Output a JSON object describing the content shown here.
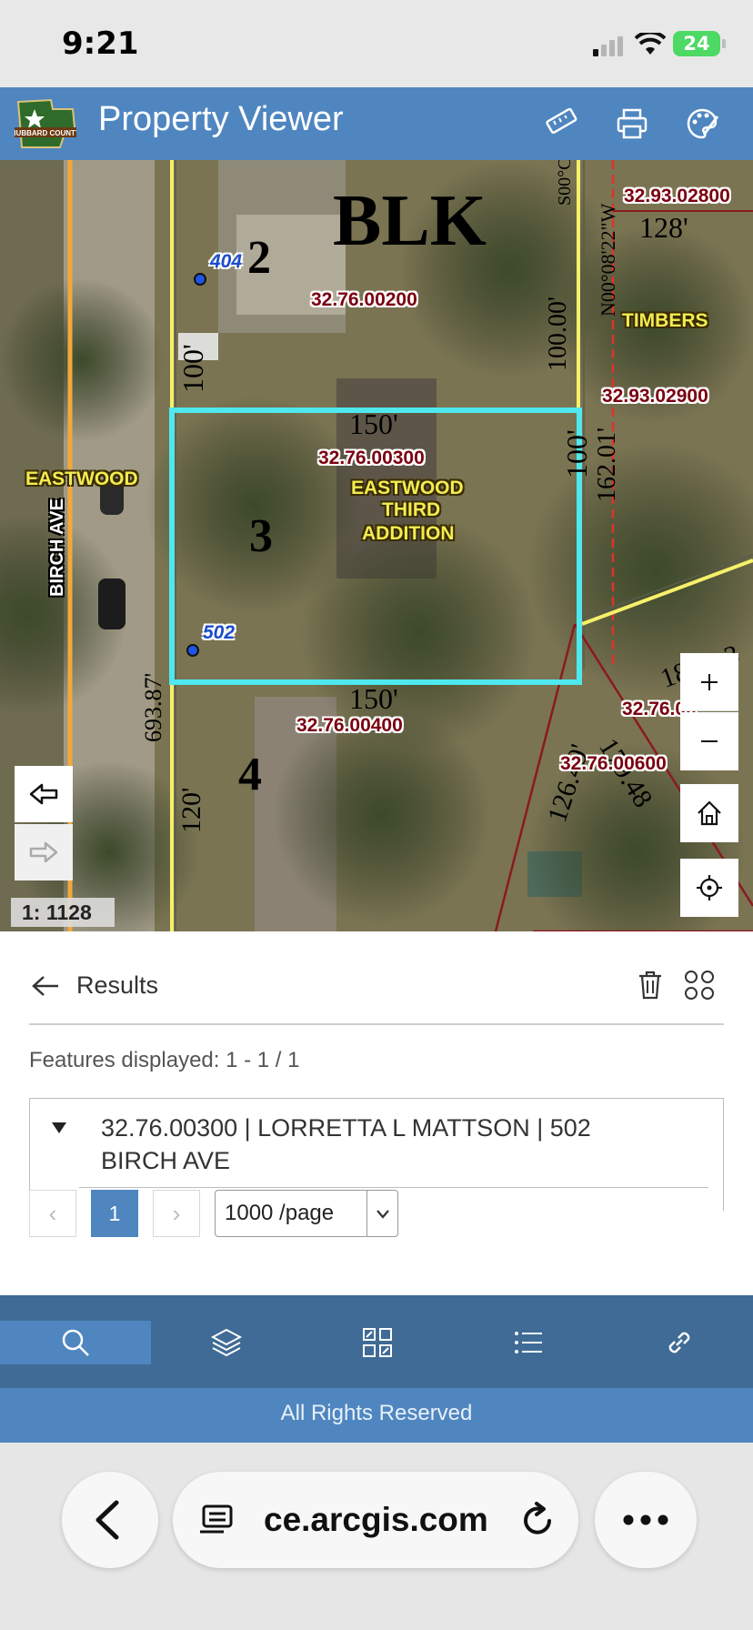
{
  "status_bar": {
    "time": "9:21",
    "battery": "24"
  },
  "header": {
    "title": "Property Viewer",
    "logo_text": "HUBBARD COUNTY",
    "tools": [
      "ruler-icon",
      "print-icon",
      "palette-icon"
    ],
    "color": "#4f86c0"
  },
  "map": {
    "parcel_labels": [
      "32.93.02800",
      "32.76.00200",
      "32.93.02900",
      "32.76.00300",
      "32.76.00400",
      "32.76.00600",
      "32.76.00"
    ],
    "lot_numbers": [
      "2",
      "3",
      "4"
    ],
    "block_label": "BLK",
    "street_labels": [
      "EASTWOOD",
      "BIRCH AVE"
    ],
    "subdivision_labels": [
      "EASTWOOD",
      "THIRD",
      "ADDITION"
    ],
    "timbers_label": "TIMBERS",
    "address_points": [
      "404",
      "502"
    ],
    "dimensions": {
      "top_150": "150'",
      "bottom_150": "150'",
      "right_100": "100'",
      "left_100": "100'",
      "upper_100": "100.00'",
      "d_128": "128'",
      "d_162": "162.01'",
      "d_693": "693.87'",
      "d_120": "120'",
      "d_126": "126.49'",
      "d_179": "179.48",
      "d_18": "18",
      "bearing": "N00°08'22\"W",
      "s00": "S00°C",
      "three": "3"
    },
    "scale": "1: 1128",
    "controls": [
      "zoom-in",
      "zoom-out",
      "home",
      "locate"
    ],
    "selection_color": "#4ee8ee"
  },
  "results": {
    "title": "Results",
    "features_displayed": "Features displayed: 1 - 1 / 1",
    "feature": "32.76.00300 | LORRETTA L MATTSON | 502 BIRCH AVE",
    "pagination": {
      "prev": "‹",
      "current": "1",
      "next": "›",
      "page_size": "1000 /page"
    }
  },
  "bottom_nav": {
    "items": [
      "search-icon",
      "layers-icon",
      "qr-icon",
      "list-icon",
      "link-icon"
    ]
  },
  "footer": {
    "text": "All Rights Reserved"
  },
  "browser": {
    "url": "ce.arcgis.com"
  }
}
